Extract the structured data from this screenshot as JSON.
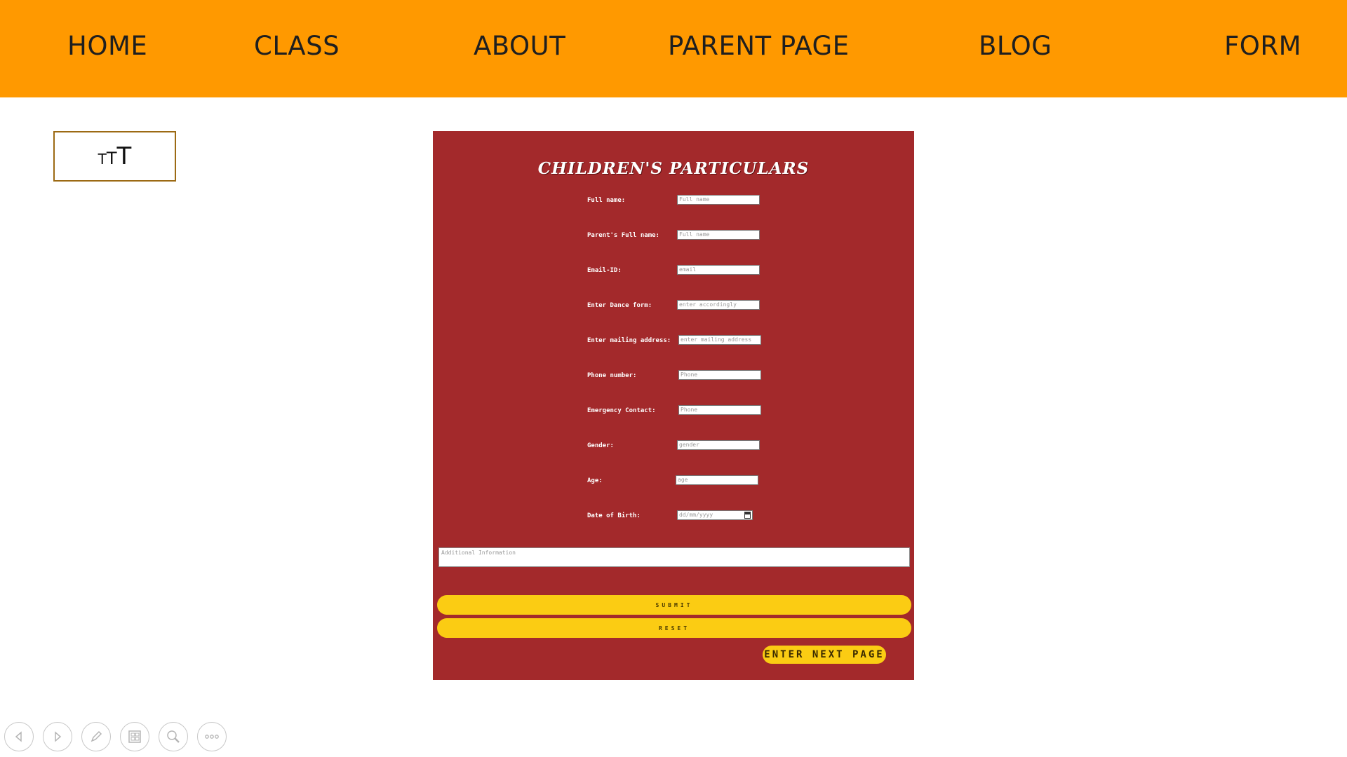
{
  "nav": {
    "home": "HOME",
    "class": "CLASS",
    "about": "ABOUT",
    "parent_page": "PARENT PAGE",
    "blog": "BLOG",
    "form": "FORM"
  },
  "logo": {
    "text_small": "T",
    "text_mid": "T",
    "text_large": "T"
  },
  "form": {
    "title": "CHILDREN'S PARTICULARS",
    "fields": [
      {
        "label": "Full name:",
        "placeholder": "Full name"
      },
      {
        "label": "Parent's Full name:",
        "placeholder": "Full name"
      },
      {
        "label": "Email-ID:",
        "placeholder": "email"
      },
      {
        "label": "Enter Dance form:",
        "placeholder": "enter accordingly"
      },
      {
        "label": "Enter mailing address:",
        "placeholder": "enter mailing address"
      },
      {
        "label": "Phone number:",
        "placeholder": "Phone"
      },
      {
        "label": "Emergency Contact:",
        "placeholder": "Phone"
      },
      {
        "label": "Gender:",
        "placeholder": "gender"
      },
      {
        "label": "Age:",
        "placeholder": "age"
      },
      {
        "label": "Date of Birth:",
        "placeholder": "dd/mm/yyyy"
      }
    ],
    "additional_placeholder": "Additional Information",
    "submit_label": "SUBMIT",
    "reset_label": "RESET",
    "next_label": "ENTER NEXT PAGE"
  },
  "colors": {
    "navbar": "#ff9900",
    "form_background": "#a3292b",
    "button": "#fbcc13"
  },
  "toolbar_icons": [
    "previous-icon",
    "next-icon",
    "pen-icon",
    "slides-grid-icon",
    "zoom-icon",
    "more-icon"
  ]
}
